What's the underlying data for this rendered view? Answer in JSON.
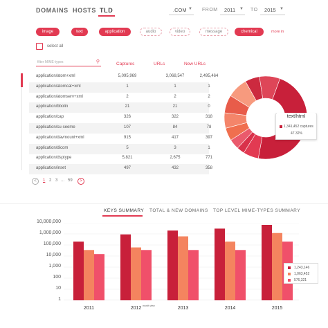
{
  "nav": {
    "domains": "DOMAINS",
    "hosts": "HOSTS",
    "tld": "TLD",
    "tld_value": ".COM",
    "from_label": "FROM",
    "from_value": "2011",
    "to_label": "TO",
    "to_value": "2015"
  },
  "filters": {
    "chips": [
      {
        "label": "image",
        "active": true
      },
      {
        "label": "text",
        "active": true
      },
      {
        "label": "application",
        "active": true
      },
      {
        "label": "audio",
        "active": false
      },
      {
        "label": "video",
        "active": false
      },
      {
        "label": "message",
        "active": false
      },
      {
        "label": "chemical",
        "active": true
      }
    ],
    "more_label": "more in",
    "select_all": "select all"
  },
  "table": {
    "filter_placeholder": "filter MIME-types",
    "headers": [
      "Captures",
      "URLs",
      "New URLs"
    ],
    "rows": [
      {
        "mime": "application/atom+xml",
        "captures": "5,095,969",
        "urls": "3,068,547",
        "new_urls": "2,495,464"
      },
      {
        "mime": "application/atomcat+xml",
        "captures": "1",
        "urls": "1",
        "new_urls": "1"
      },
      {
        "mime": "application/atomserv+xml",
        "captures": "2",
        "urls": "2",
        "new_urls": "2"
      },
      {
        "mime": "application/bbolin",
        "captures": "21",
        "urls": "21",
        "new_urls": "0"
      },
      {
        "mime": "application/cap",
        "captures": "326",
        "urls": "322",
        "new_urls": "318"
      },
      {
        "mime": "application/cu-seeme",
        "captures": "107",
        "urls": "84",
        "new_urls": "78"
      },
      {
        "mime": "application/davmount+xml",
        "captures": "915",
        "urls": "417",
        "new_urls": "397"
      },
      {
        "mime": "application/dicom",
        "captures": "5",
        "urls": "3",
        "new_urls": "1"
      },
      {
        "mime": "application/dsptype",
        "captures": "5,821",
        "urls": "2,675",
        "new_urls": "771"
      },
      {
        "mime": "application/inset",
        "captures": "497",
        "urls": "432",
        "new_urls": "358"
      }
    ]
  },
  "pagination": {
    "prev": "<",
    "current": "1",
    "pages": [
      "2",
      "3",
      "...",
      "59"
    ],
    "next": ">"
  },
  "donut": {
    "tooltip_title": "text/html",
    "tooltip_captures": "1,341,452 captures",
    "tooltip_percent": "47.32%",
    "slices": [
      47.32,
      6,
      3,
      4,
      5,
      6,
      7,
      8,
      5.68,
      8
    ],
    "colors": [
      "#c8203a",
      "#e23a52",
      "#d9314a",
      "#ea5a6c",
      "#f06f4f",
      "#f4856a",
      "#e85c4a",
      "#f79a7e",
      "#cc2a3f",
      "#de4658"
    ]
  },
  "tabs": {
    "items": [
      "KEYS SUMMARY",
      "TOTAL & NEW DOMAINS",
      "TOP LEVEL MIME-TYPES SUMMARY"
    ],
    "active": 0
  },
  "chart_data": {
    "type": "bar",
    "categories": [
      "2011",
      "2012",
      "2013",
      "2014",
      "2015"
    ],
    "yscale": "log",
    "ylim": [
      1,
      10000000
    ],
    "yticks": [
      "10,000,000",
      "1,000,000",
      "100,000",
      "10,000",
      "1,000",
      "100",
      "10",
      "1"
    ],
    "series": [
      {
        "color": "#c8203a",
        "values": [
          200000,
          900000,
          2000000,
          3000000,
          6500000
        ]
      },
      {
        "color": "#f4845f",
        "values": [
          35000,
          60000,
          600000,
          200000,
          1200000
        ]
      },
      {
        "color": "#f0506a",
        "values": [
          15000,
          35000,
          35000,
          35000,
          200000
        ]
      }
    ],
    "legend_values": [
      "1,243,146",
      "1,063,452",
      "576,321"
    ],
    "legend_colors": [
      "#c8203a",
      "#f4845f",
      "#f0506a"
    ],
    "mini_note": "month view"
  }
}
